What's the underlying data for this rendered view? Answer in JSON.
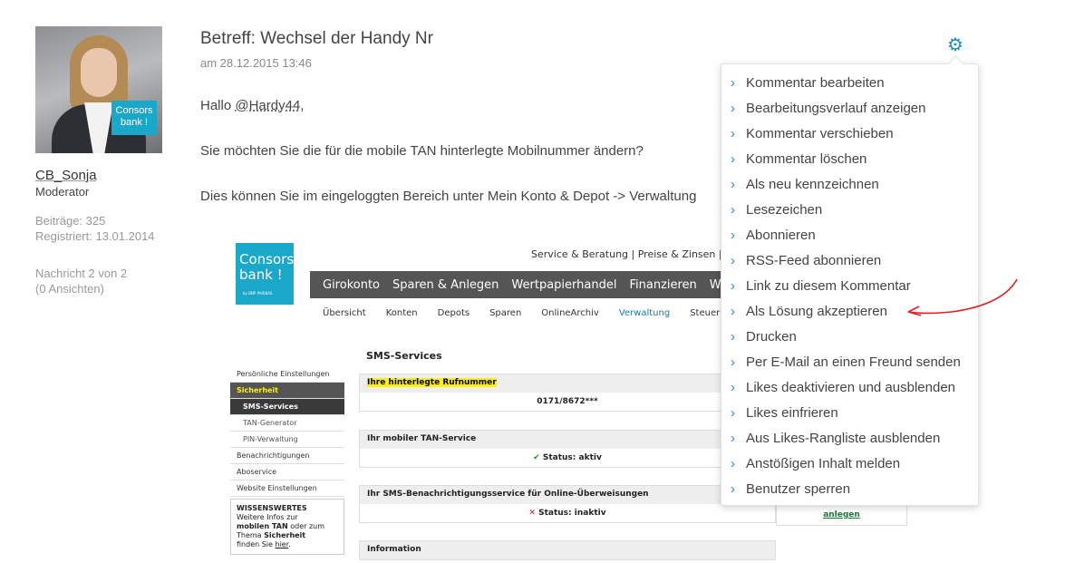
{
  "author": {
    "name": "CB_Sonja",
    "role": "Moderator",
    "posts": "Beiträge: 325",
    "registered": "Registriert: 13.01.2014",
    "message_pos": "Nachricht 2 von 2",
    "views": "(0 Ansichten)",
    "avatar_logo": "Consors bank !"
  },
  "post": {
    "subject": "Betreff: Wechsel der Handy Nr",
    "date": "am 28.12.2015 13:46",
    "greeting": "Hallo ",
    "mention": "@Hardy44",
    "greeting_end": ",",
    "line1": "Sie möchten Sie die für die mobile TAN hinterlegte Mobilnummer ändern?",
    "line2": "Dies können Sie im eingeloggten Bereich unter Mein Konto & Depot -> Verwaltung"
  },
  "screenshot": {
    "logo": "Consors bank !",
    "logo_small": "by BNP PARIBAS",
    "topnav": "Service & Beratung  |  Preise & Zinsen  |  Üb",
    "mainnav": [
      "Girokonto",
      "Sparen & Anlegen",
      "Wertpapierhandel",
      "Finanzieren",
      "Wissen"
    ],
    "subnav": [
      "Übersicht",
      "Konten",
      "Depots",
      "Sparen",
      "OnlineArchiv",
      "Verwaltung",
      "Steuer"
    ],
    "side": {
      "personal": "Persönliche Einstellungen",
      "security": "Sicherheit",
      "sms": "SMS-Services",
      "tan": "TAN-Generator",
      "pin": "PIN-Verwaltung",
      "notifications": "Benachrichtigungen",
      "abo": "Aboservice",
      "website": "Website Einstellungen",
      "info_title": "WISSENSWERTES",
      "info_text1": "Weitere Infos zur",
      "info_text2": "mobilen TAN",
      "info_text3": "oder zum",
      "info_text4": "Thema",
      "info_text5": "Sicherheit",
      "info_text6": "finden Sie",
      "info_link": "hier",
      "info_end": "."
    },
    "sms_title": "SMS-Services",
    "box1_title": "Ihre hinterlegte Rufnummer",
    "box1_value": "0171/8672***",
    "box2_title": "Ihr mobiler TAN-Service",
    "box2_value": "Status: aktiv",
    "box3_title": "Ihr SMS-Benachrichtigungsservice für Online-Überweisungen",
    "box3_value": "Status: inaktiv",
    "box3_action": "anlegen",
    "box4_title": "Information"
  },
  "menu": {
    "items": [
      "Kommentar bearbeiten",
      "Bearbeitungsverlauf anzeigen",
      "Kommentar verschieben",
      "Kommentar löschen",
      "Als neu kennzeichnen",
      "Lesezeichen",
      "Abonnieren",
      "RSS-Feed abonnieren",
      "Link zu diesem Kommentar",
      "Als Lösung akzeptieren",
      "Drucken",
      "Per E-Mail an einen Freund senden",
      "Likes deaktivieren und ausblenden",
      "Likes einfrieren",
      "Aus Likes-Rangliste ausblenden",
      "Anstößigen Inhalt melden",
      "Benutzer sperren"
    ]
  },
  "colors": {
    "accent": "#1a8cc0",
    "annotation": "#e02020",
    "highlight": "#fff200"
  },
  "icons": {
    "gear": "gear-icon",
    "chevron": "chevron-right-icon"
  }
}
